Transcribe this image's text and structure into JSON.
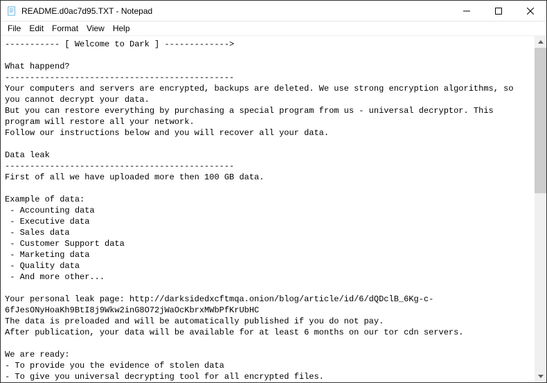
{
  "titlebar": {
    "title": "README.d0ac7d95.TXT - Notepad",
    "minimize": "—",
    "maximize": "☐",
    "close": "✕"
  },
  "menubar": {
    "file": "File",
    "edit": "Edit",
    "format": "Format",
    "view": "View",
    "help": "Help"
  },
  "content": "----------- [ Welcome to Dark ] ------------->\n\nWhat happend?\n----------------------------------------------\nYour computers and servers are encrypted, backups are deleted. We use strong encryption algorithms, so you cannot decrypt your data.\nBut you can restore everything by purchasing a special program from us - universal decryptor. This program will restore all your network.\nFollow our instructions below and you will recover all your data.\n\nData leak\n----------------------------------------------\nFirst of all we have uploaded more then 100 GB data.\n\nExample of data:\n - Accounting data\n - Executive data\n - Sales data\n - Customer Support data\n - Marketing data\n - Quality data\n - And more other...\n\nYour personal leak page: http://darksidedxcftmqa.onion/blog/article/id/6/dQDclB_6Kg-c-6fJesONyHoaKh9BtI8j9Wkw2inG8O72jWaOcKbrxMWbPfKrUbHC\nThe data is preloaded and will be automatically published if you do not pay.\nAfter publication, your data will be available for at least 6 months on our tor cdn servers.\n\nWe are ready:\n- To provide you the evidence of stolen data\n- To give you universal decrypting tool for all encrypted files.\n- To delete all the stolen data."
}
